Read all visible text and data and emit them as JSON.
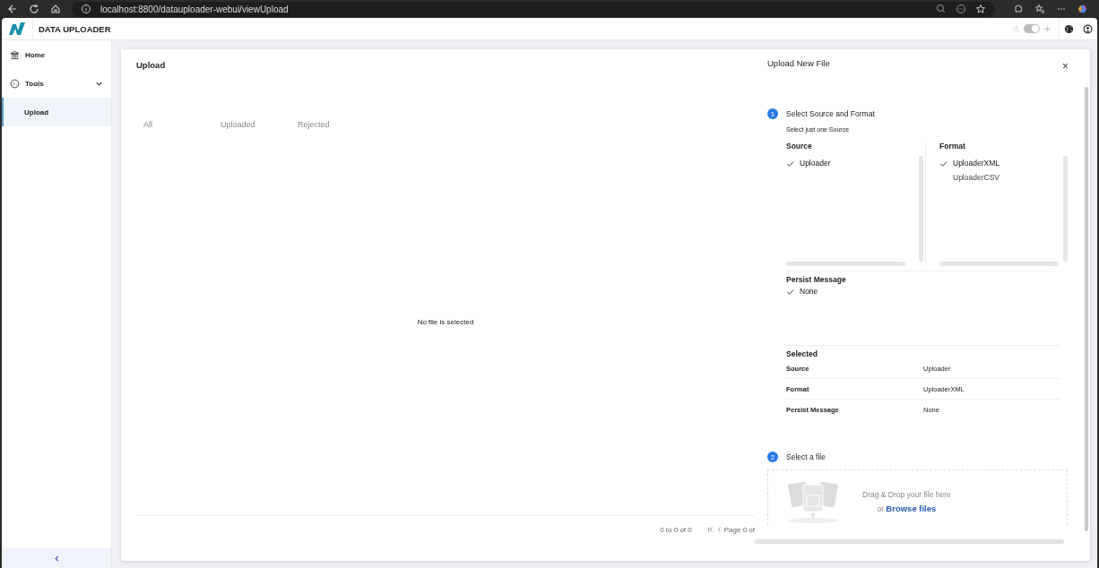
{
  "browser": {
    "url": "localhost:8800/datauploader-webui/viewUpload"
  },
  "app": {
    "title": "DATA UPLOADER",
    "theme_toggle": {
      "on": true
    }
  },
  "sidebar": {
    "items": [
      {
        "label": "Home"
      },
      {
        "label": "Tools",
        "expanded": true,
        "children": [
          {
            "label": "Upload",
            "selected": true
          }
        ]
      }
    ]
  },
  "upload": {
    "title": "Upload",
    "tabs": [
      {
        "label": "All",
        "selected": false
      },
      {
        "label": "Uploaded",
        "selected": false
      },
      {
        "label": "Rejected",
        "selected": false
      }
    ],
    "empty_message": "No file is selected",
    "pager": {
      "range": "0 to 0 of 0",
      "page": "Page 0 of"
    }
  },
  "panel": {
    "title": "Upload New File",
    "close": "×",
    "step1": {
      "number": "1",
      "title": "Select Source and Format",
      "hint": "Select just one Source",
      "source": {
        "label": "Source",
        "items": [
          {
            "label": "Uploader",
            "selected": true
          }
        ]
      },
      "format": {
        "label": "Format",
        "items": [
          {
            "label": "UploaderXML",
            "selected": true
          },
          {
            "label": "UploaderCSV",
            "selected": false
          }
        ]
      },
      "persist": {
        "label": "Persist Message",
        "items": [
          {
            "label": "None",
            "selected": true
          }
        ]
      },
      "summary": {
        "title": "Selected",
        "rows": [
          {
            "label": "Source",
            "value": "Uploader"
          },
          {
            "label": "Format",
            "value": "UploaderXML"
          },
          {
            "label": "Persist Message",
            "value": "None"
          }
        ]
      }
    },
    "step2": {
      "number": "2",
      "title": "Select a file",
      "drop_text": "Drag & Drop your file here",
      "or": "or",
      "browse": "Browse files"
    }
  }
}
